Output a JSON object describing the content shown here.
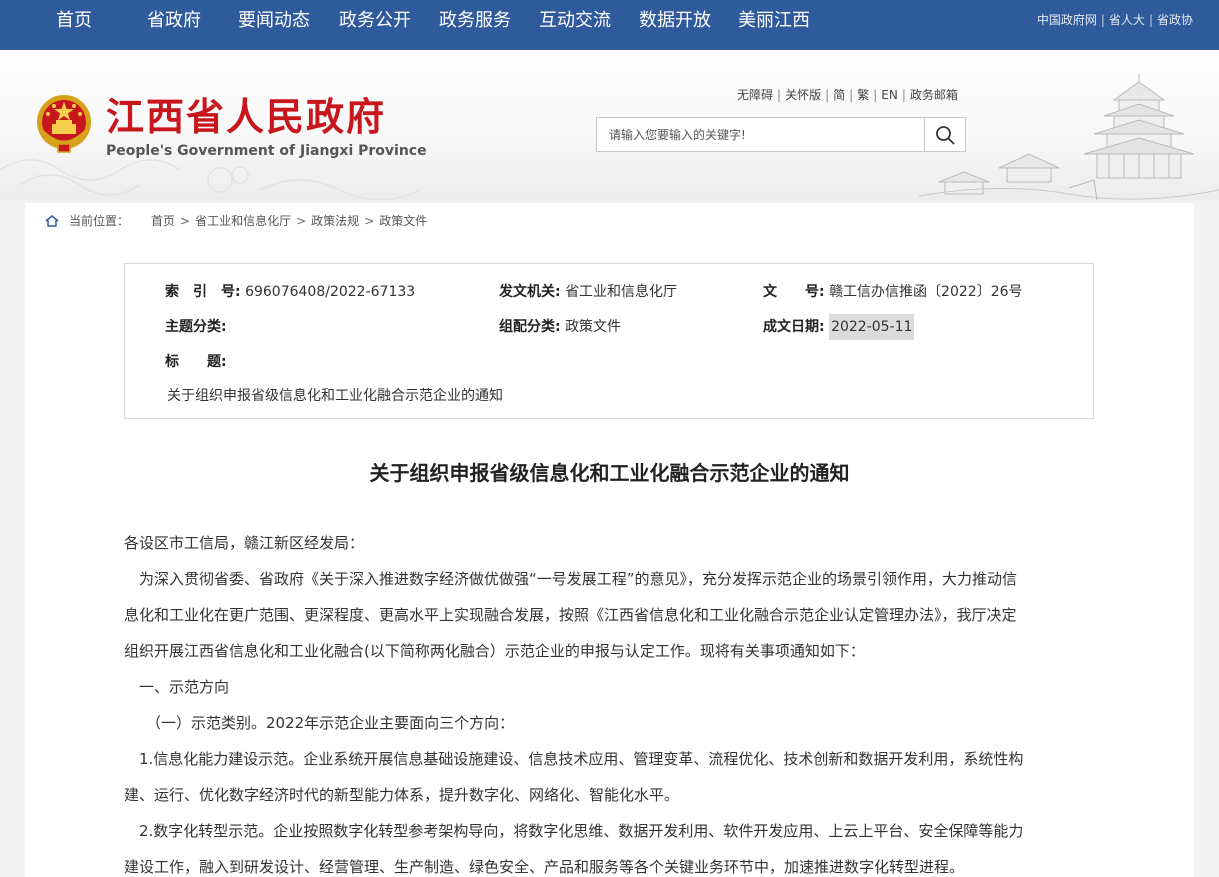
{
  "topnav": {
    "items": [
      "首页",
      "省政府",
      "要闻动态",
      "政务公开",
      "政务服务",
      "互动交流",
      "数据开放",
      "美丽江西"
    ],
    "links": [
      "中国政府网",
      "省人大",
      "省政协"
    ]
  },
  "header": {
    "title_cn": "江西省人民政府",
    "title_en": "People's Government of Jiangxi Province",
    "utility": [
      "无障碍",
      "关怀版",
      "简",
      "繁",
      "EN",
      "政务邮箱"
    ],
    "search_placeholder": "请输入您要输入的关键字!"
  },
  "breadcrumb": {
    "label": "当前位置：",
    "items": [
      "首页",
      "省工业和信息化厅",
      "政策法规",
      "政策文件"
    ],
    "separator": ">"
  },
  "meta": {
    "index_label": "索　引　号:",
    "index_value": "696076408/2022-67133",
    "issuer_label": "发文机关:",
    "issuer_value": "省工业和信息化厅",
    "docno_label": "文　　号:",
    "docno_value": "赣工信办信推函〔2022〕26号",
    "topic_label": "主题分类:",
    "topic_value": "",
    "category_label": "组配分类:",
    "category_value": "政策文件",
    "date_label": "成文日期:",
    "date_value": "2022-05-11",
    "title_label": "标　　题:",
    "title_value": "关于组织申报省级信息化和工业化融合示范企业的通知"
  },
  "document": {
    "title": "关于组织申报省级信息化和工业化融合示范企业的通知",
    "paragraphs": [
      "各设区市工信局，赣江新区经发局：",
      "为深入贯彻省委、省政府《关于深入推进数字经济做优做强“一号发展工程”的意见》，充分发挥示范企业的场景引领作用，大力推动信",
      "息化和工业化在更广范围、更深程度、更高水平上实现融合发展，按照《江西省信息化和工业化融合示范企业认定管理办法》，我厅决定",
      "组织开展江西省信息化和工业化融合(以下简称两化融合）示范企业的申报与认定工作。现将有关事项通知如下：",
      "一、示范方向",
      "（一）示范类别。2022年示范企业主要面向三个方向：",
      "1.信息化能力建设示范。企业系统开展信息基础设施建设、信息技术应用、管理变革、流程优化、技术创新和数据开发利用，系统性构",
      "建、运行、优化数字经济时代的新型能力体系，提升数字化、网络化、智能化水平。",
      "2.数字化转型示范。企业按照数字化转型参考架构导向，将数字化思维、数据开发利用、软件开发应用、上云上平台、安全保障等能力",
      "建设工作，融入到研发设计、经营管理、生产制造、绿色安全、产品和服务等各个关键业务环节中，加速推进数字化转型进程。"
    ]
  },
  "colors": {
    "nav_bg": "#2f5a9c",
    "brand_red": "#c8161d"
  }
}
